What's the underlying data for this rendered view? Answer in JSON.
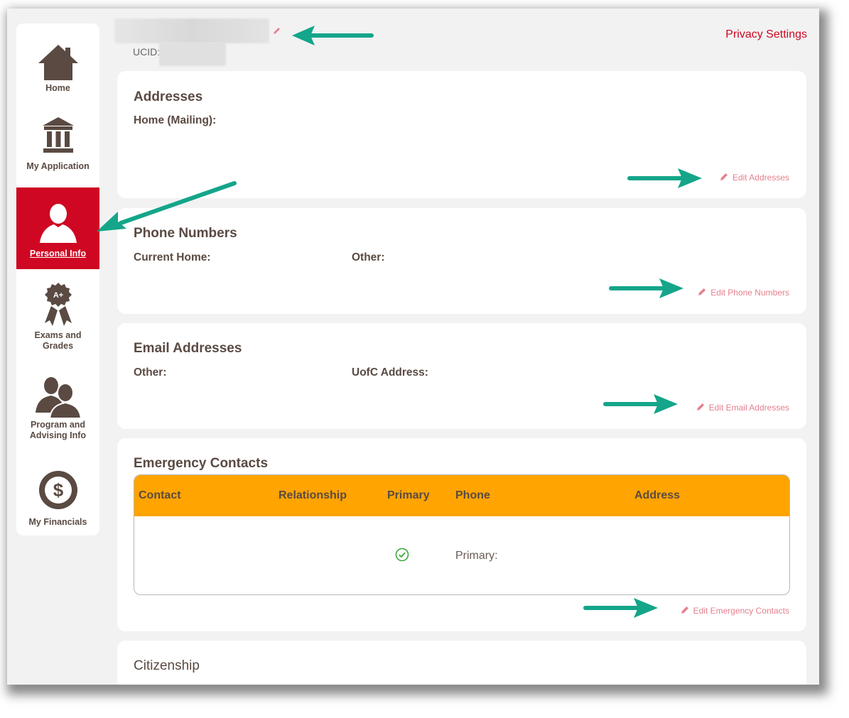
{
  "sidebar": {
    "items": [
      {
        "label": "Home",
        "icon": "home-icon",
        "active": false
      },
      {
        "label": "My Application",
        "icon": "institution-icon",
        "active": false
      },
      {
        "label": "Personal Info",
        "icon": "person-icon",
        "active": true
      },
      {
        "label": "Exams and Grades",
        "icon": "award-ribbon-icon",
        "active": false,
        "badge": "A+"
      },
      {
        "label": "Program and Advising Info",
        "icon": "advisors-icon",
        "active": false
      },
      {
        "label": "My Financials",
        "icon": "dollar-coin-icon",
        "active": false
      }
    ]
  },
  "header": {
    "ucid_label": "UCID:",
    "privacy_link": "Privacy Settings"
  },
  "addresses": {
    "title": "Addresses",
    "home_mailing_label": "Home (Mailing):",
    "edit_label": "Edit Addresses"
  },
  "phones": {
    "title": "Phone Numbers",
    "current_home_label": "Current Home:",
    "other_label": "Other:",
    "edit_label": "Edit Phone Numbers"
  },
  "emails": {
    "title": "Email Addresses",
    "other_label": "Other:",
    "uofc_label": "UofC Address:",
    "edit_label": "Edit Email Addresses"
  },
  "emergency": {
    "title": "Emergency Contacts",
    "columns": [
      "Contact",
      "Relationship",
      "Primary",
      "Phone",
      "Address"
    ],
    "row": {
      "primary_checked": true,
      "phone_label": "Primary:"
    },
    "edit_label": "Edit Emergency Contacts"
  },
  "citizenship": {
    "title": "Citizenship"
  },
  "colors": {
    "brand_red": "#cf0722",
    "header_orange": "#ffa400",
    "annotation_teal": "#14a58a",
    "text_brown": "#5a4a42",
    "edit_pink": "#e5808d"
  }
}
